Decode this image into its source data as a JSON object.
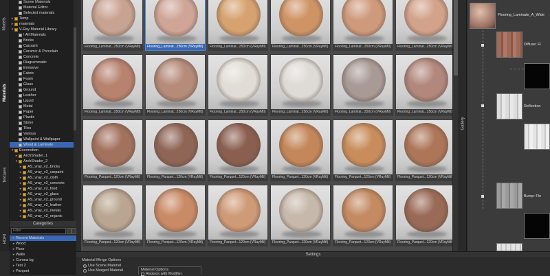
{
  "sidetabs": [
    "Models",
    "Materials",
    "Textures",
    "HDRI"
  ],
  "tree": [
    {
      "label": "Scene Materials",
      "depth": 2,
      "type": "item"
    },
    {
      "label": "Material Editor",
      "depth": 2,
      "type": "item"
    },
    {
      "label": "Selected materials",
      "depth": 2,
      "type": "item"
    },
    {
      "label": "Temp",
      "depth": 1,
      "type": "folder"
    },
    {
      "label": "materials",
      "depth": 1,
      "type": "folder"
    },
    {
      "label": "V-Ray Material Library",
      "depth": 1,
      "type": "folder",
      "open": true
    },
    {
      "label": "! All Materials",
      "depth": 2,
      "type": "item"
    },
    {
      "label": "Bricks",
      "depth": 2,
      "type": "item"
    },
    {
      "label": "Carpaint",
      "depth": 2,
      "type": "item"
    },
    {
      "label": "Ceramic & Porcelain",
      "depth": 2,
      "type": "item"
    },
    {
      "label": "Concrete",
      "depth": 2,
      "type": "item"
    },
    {
      "label": "Diagrammatic",
      "depth": 2,
      "type": "item"
    },
    {
      "label": "Emissive",
      "depth": 2,
      "type": "item"
    },
    {
      "label": "Fabric",
      "depth": 2,
      "type": "item"
    },
    {
      "label": "Foam",
      "depth": 2,
      "type": "item"
    },
    {
      "label": "Glass",
      "depth": 2,
      "type": "item"
    },
    {
      "label": "Ground",
      "depth": 2,
      "type": "item"
    },
    {
      "label": "Leather",
      "depth": 2,
      "type": "item"
    },
    {
      "label": "Liquid",
      "depth": 2,
      "type": "item"
    },
    {
      "label": "Metal",
      "depth": 2,
      "type": "item"
    },
    {
      "label": "Paper",
      "depth": 2,
      "type": "item"
    },
    {
      "label": "Plastic",
      "depth": 2,
      "type": "item"
    },
    {
      "label": "Stone",
      "depth": 2,
      "type": "item"
    },
    {
      "label": "Tiles",
      "depth": 2,
      "type": "item"
    },
    {
      "label": "Various",
      "depth": 2,
      "type": "item"
    },
    {
      "label": "Wallpaint & Wallpaper",
      "depth": 2,
      "type": "item"
    },
    {
      "label": "Wood & Laminate",
      "depth": 2,
      "type": "item",
      "selected": true
    },
    {
      "label": "Evermotion",
      "depth": 1,
      "type": "folder",
      "open": true
    },
    {
      "label": "ArchShader_1",
      "depth": 2,
      "type": "folder"
    },
    {
      "label": "ArchShader_2",
      "depth": 2,
      "type": "folder",
      "open": true
    },
    {
      "label": "AS_vray_v2_bricks",
      "depth": 3,
      "type": "folder"
    },
    {
      "label": "AS_vray_v2_carpaint",
      "depth": 3,
      "type": "folder"
    },
    {
      "label": "AS_vray_v2_cloth",
      "depth": 3,
      "type": "folder"
    },
    {
      "label": "AS_vray_v2_concrete",
      "depth": 3,
      "type": "folder"
    },
    {
      "label": "AS_vray_v2_food",
      "depth": 3,
      "type": "folder"
    },
    {
      "label": "AS_vray_v2_glass",
      "depth": 3,
      "type": "folder"
    },
    {
      "label": "AS_vray_v2_ground",
      "depth": 3,
      "type": "folder"
    },
    {
      "label": "AS_vray_v2_leather",
      "depth": 3,
      "type": "folder"
    },
    {
      "label": "AS_vray_v2_metals",
      "depth": 3,
      "type": "folder"
    },
    {
      "label": "AS_vray_v2_organic",
      "depth": 3,
      "type": "folder"
    }
  ],
  "categories_title": "Categories",
  "categories_search_placeholder": "Filter",
  "categories": [
    {
      "label": "Recent Materials",
      "selected": true
    },
    {
      "label": "Wood"
    },
    {
      "label": "Floor"
    },
    {
      "label": "Walls"
    },
    {
      "label": "Corona bg"
    },
    {
      "label": "Test 2"
    },
    {
      "label": "Parquet"
    }
  ],
  "tiles": [
    {
      "caption": "Flooring_Laminat...250cm (VRayMtl)",
      "color": "#c9a392"
    },
    {
      "caption": "Flooring_Laminat...250cm (VRayMtl)",
      "color": "#cea596",
      "selected": true
    },
    {
      "caption": "Flooring_Laminat...250cm (VRayMtl)",
      "color": "#d6a270"
    },
    {
      "caption": "Flooring_Laminat...250cm (VRayMtl)",
      "color": "#cf9466"
    },
    {
      "caption": "Flooring_Laminat...250cm (VRayMtl)",
      "color": "#cf9a7c"
    },
    {
      "caption": "Flooring_Laminat...250cm (VRayMtl)",
      "color": "#d2a28a"
    },
    {
      "caption": "Flooring_Laminat...250cm (VRayMtl)",
      "color": "#b7836f"
    },
    {
      "caption": "Flooring_Laminat...250cm (VRayMtl)",
      "color": "#b58b7a"
    },
    {
      "caption": "Flooring_Laminat...250cm (VRayMtl)",
      "color": "#e1ddd6"
    },
    {
      "caption": "Flooring_Laminat...250cm (VRayMtl)",
      "color": "#dedbd6"
    },
    {
      "caption": "Flooring_Laminat...250cm (VRayMtl)",
      "color": "#a99a96"
    },
    {
      "caption": "Flooring_Laminat...250cm (VRayMtl)",
      "color": "#b2877c"
    },
    {
      "caption": "Flooring_Parquet...120cm (VRayMtl)",
      "color": "#a2725e"
    },
    {
      "caption": "Flooring_Parquet...120cm (VRayMtl)",
      "color": "#8f6556"
    },
    {
      "caption": "Flooring_Parquet...120cm (VRayMtl)",
      "color": "#8a5f4f"
    },
    {
      "caption": "Flooring_Parquet...120cm (VRayMtl)",
      "color": "#c4875a"
    },
    {
      "caption": "Flooring_Parquet...120cm (VRayMtl)",
      "color": "#c98d5c"
    },
    {
      "caption": "Flooring_Parquet...120cm (VRayMtl)",
      "color": "#ad7659"
    },
    {
      "caption": "Flooring_Parquet...120cm (VRayMtl)",
      "color": "#b9a590"
    },
    {
      "caption": "Flooring_Parquet...120cm (VRayMtl)",
      "color": "#c98a66"
    },
    {
      "caption": "Flooring_Parquet...120cm (VRayMtl)",
      "color": "#cf9a77"
    },
    {
      "caption": "Flooring_Parquet...120cm (VRayMtl)",
      "color": "#c6b8aa"
    },
    {
      "caption": "Flooring_Parquet...120cm (VRayMtl)",
      "color": "#c48a62"
    },
    {
      "caption": "Flooring_Parquet...120cm (VRayMtl)",
      "color": "#9a6a57"
    }
  ],
  "gallery_label": "Gallery",
  "preview": {
    "name": "Flooring_Laminate_A_Wide",
    "nodes": [
      "Diffuse: Fl",
      "Reflection",
      "Bump: Flo"
    ]
  },
  "settings": {
    "title": "Settings",
    "merge_options_title": "Material Merge Options",
    "merge_options": [
      {
        "label": "Use Scene Material",
        "selected": true
      },
      {
        "label": "Use Merged Material",
        "selected": false
      }
    ],
    "material_options_title": "Material Options",
    "material_options_item": "Replace with Modifier"
  }
}
